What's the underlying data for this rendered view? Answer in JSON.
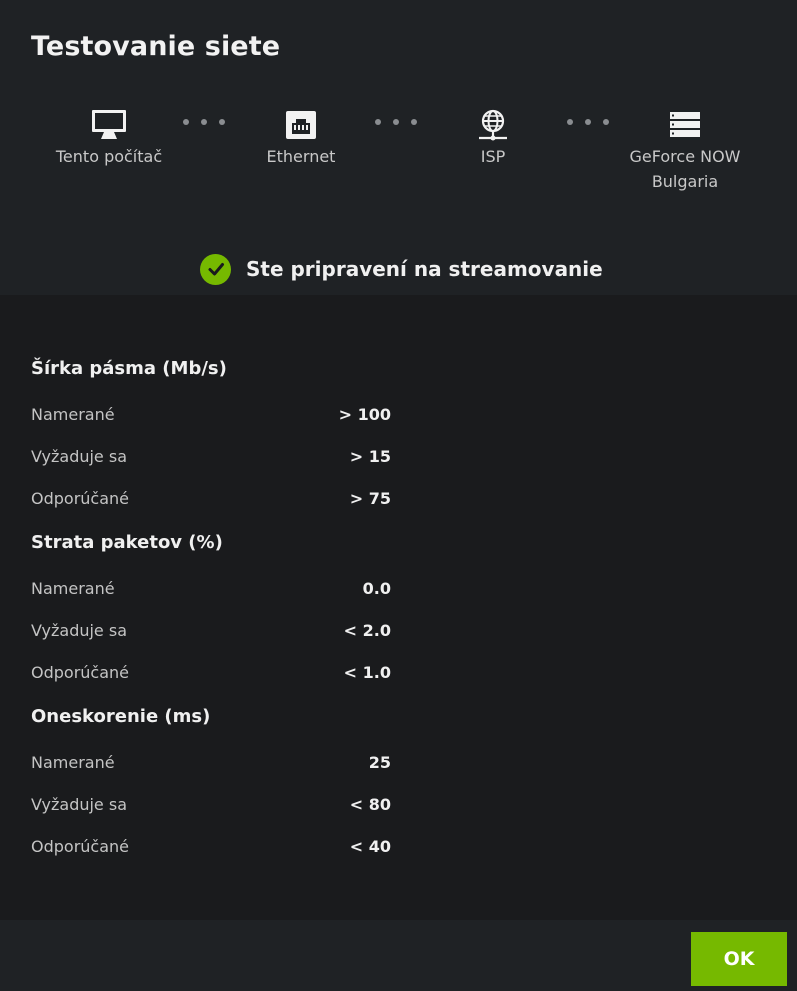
{
  "dialog": {
    "title": "Testovanie siete"
  },
  "path": {
    "nodes": [
      {
        "label": "Tento počítač",
        "icon": "monitor-icon"
      },
      {
        "label": "Ethernet",
        "icon": "ethernet-port-icon"
      },
      {
        "label": "ISP",
        "icon": "globe-network-icon"
      },
      {
        "label": "GeForce NOW\nBulgaria",
        "icon": "server-icon"
      }
    ]
  },
  "status": {
    "text": "Ste pripravení na streamovanie",
    "icon": "check-circle-icon",
    "color": "#76b900"
  },
  "sections": [
    {
      "title": "Šírka pásma (Mb/s)",
      "rows": [
        {
          "label": "Namerané",
          "value": "> 100"
        },
        {
          "label": "Vyžaduje sa",
          "value": "> 15"
        },
        {
          "label": "Odporúčané",
          "value": "> 75"
        }
      ]
    },
    {
      "title": "Strata paketov (%)",
      "rows": [
        {
          "label": "Namerané",
          "value": "0.0"
        },
        {
          "label": "Vyžaduje sa",
          "value": "< 2.0"
        },
        {
          "label": "Odporúčané",
          "value": "< 1.0"
        }
      ]
    },
    {
      "title": "Oneskorenie (ms)",
      "rows": [
        {
          "label": "Namerané",
          "value": "25"
        },
        {
          "label": "Vyžaduje sa",
          "value": "< 80"
        },
        {
          "label": "Odporúčané",
          "value": "< 40"
        }
      ]
    }
  ],
  "footer": {
    "ok_label": "OK",
    "accent": "#76b900"
  }
}
